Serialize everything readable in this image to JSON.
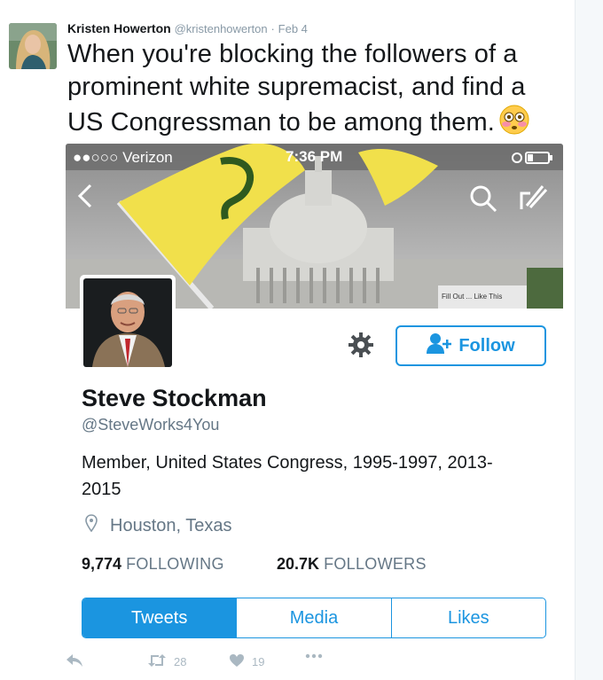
{
  "tweet": {
    "author_name": "Kristen Howerton",
    "author_handle": "@kristenhowerton",
    "separator": "·",
    "date": "Feb 4",
    "text": "When you're blocking the followers of a prominent white supremacist, and find a US Congressman to be among them.",
    "emoji": "flushed-face"
  },
  "screenshot": {
    "status_bar": {
      "carrier": "●●○○○ Verizon",
      "time": "7:36 PM"
    },
    "banner_sign_text": "Fill Out ... Like This",
    "profile": {
      "name": "Steve Stockman",
      "handle": "@SteveWorks4You",
      "bio": "Member, United States Congress, 1995-1997, 2013-2015",
      "location": "Houston, Texas",
      "following_count": "9,774",
      "following_label": "FOLLOWING",
      "followers_count": "20.7K",
      "followers_label": "FOLLOWERS",
      "follow_button_label": "Follow"
    },
    "tabs": [
      {
        "label": "Tweets",
        "active": true
      },
      {
        "label": "Media",
        "active": false
      },
      {
        "label": "Likes",
        "active": false
      }
    ]
  },
  "actions": {
    "retweets": "28",
    "likes": "19"
  },
  "colors": {
    "accent": "#1b95e0",
    "muted": "#8899a6",
    "text": "#14171a"
  }
}
